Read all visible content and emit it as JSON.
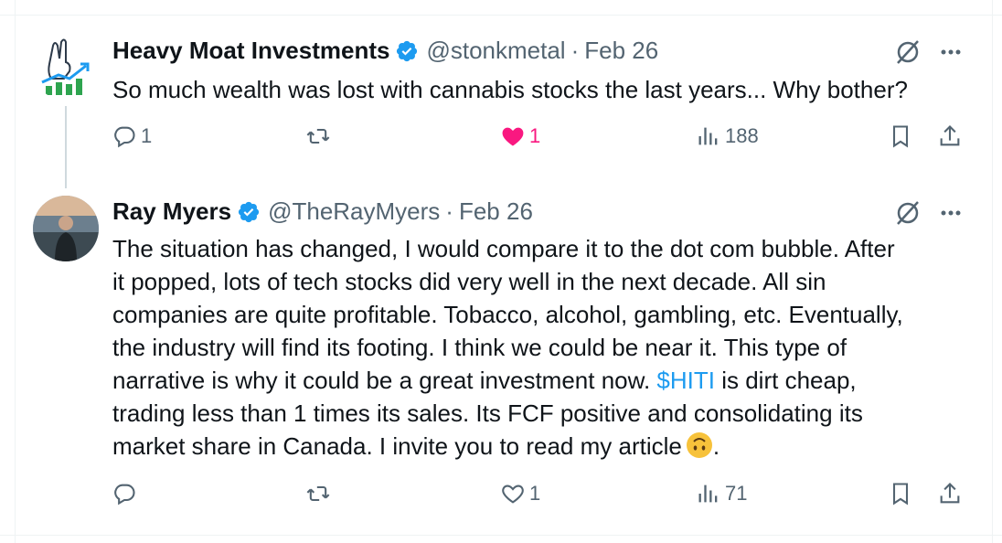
{
  "tweets": [
    {
      "name": "Heavy Moat Investments",
      "handle": "@stonkmetal",
      "separator": "·",
      "date": "Feb 26",
      "text": "So much wealth was lost with cannabis stocks the last years... Why bother?",
      "reply_count": "1",
      "retweet_count": "",
      "like_count": "1",
      "views": "188",
      "liked": true
    },
    {
      "name": "Ray Myers",
      "handle": "@TheRayMyers",
      "separator": "·",
      "date": "Feb 26",
      "text_lines": [
        "The situation has changed, I would compare it to the dot com bubble. After",
        "it popped, lots of tech stocks did very well in the next decade. All sin",
        "companies are quite profitable. Tobacco, alcohol, gambling, etc. Eventually,",
        "the industry will find its footing. I think we could be near it. This type of"
      ],
      "text_line5_before": "narrative is why it could be a great investment now. ",
      "cashtag": "$HITI",
      "text_line5_after": " is dirt cheap,",
      "text_line6": "trading less than 1 times its sales. Its FCF positive and consolidating its",
      "text_line7_before": "market share in Canada. I invite you to read my article",
      "text_line7_after": ".",
      "emoji": "upside-down-face",
      "reply_count": "",
      "retweet_count": "",
      "like_count": "1",
      "views": "71",
      "liked": false
    }
  ],
  "colors": {
    "text": "#0f1419",
    "secondary": "#536471",
    "link": "#1d9bf0",
    "like": "#f91880",
    "verified": "#1d9bf0"
  }
}
